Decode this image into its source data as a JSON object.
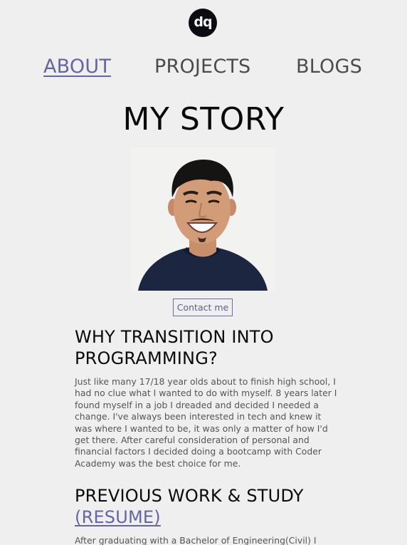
{
  "brand": {
    "logo_text": "dq"
  },
  "nav": {
    "items": [
      {
        "label": "ABOUT",
        "active": true
      },
      {
        "label": "PROJECTS",
        "active": false
      },
      {
        "label": "BLOGS",
        "active": false
      }
    ]
  },
  "page": {
    "title": "MY STORY"
  },
  "profile": {
    "contact_label": "Contact me"
  },
  "sections": [
    {
      "heading_line1": "WHY TRANSITION INTO",
      "heading_line2": "PROGRAMMING?",
      "body": "Just like many 17/18 year olds about to finish high school, I had no clue what I wanted to do with myself. 8 years later I found myself in a job I dreaded and decided I needed a change. I've always been interested in tech and knew it was where I wanted to be, it was only a matter of how I'd get there. After careful consideration of personal and financial factors I decided doing a bootcamp with Coder Academy was the best choice for me."
    },
    {
      "heading": "PREVIOUS WORK & STUDY",
      "heading_link": "(RESUME)",
      "body": "After graduating with a Bachelor of Engineering(Civil) I"
    }
  ],
  "colors": {
    "background": "#efefef",
    "accent": "#6565a0",
    "text": "#111111",
    "muted": "#555555"
  }
}
